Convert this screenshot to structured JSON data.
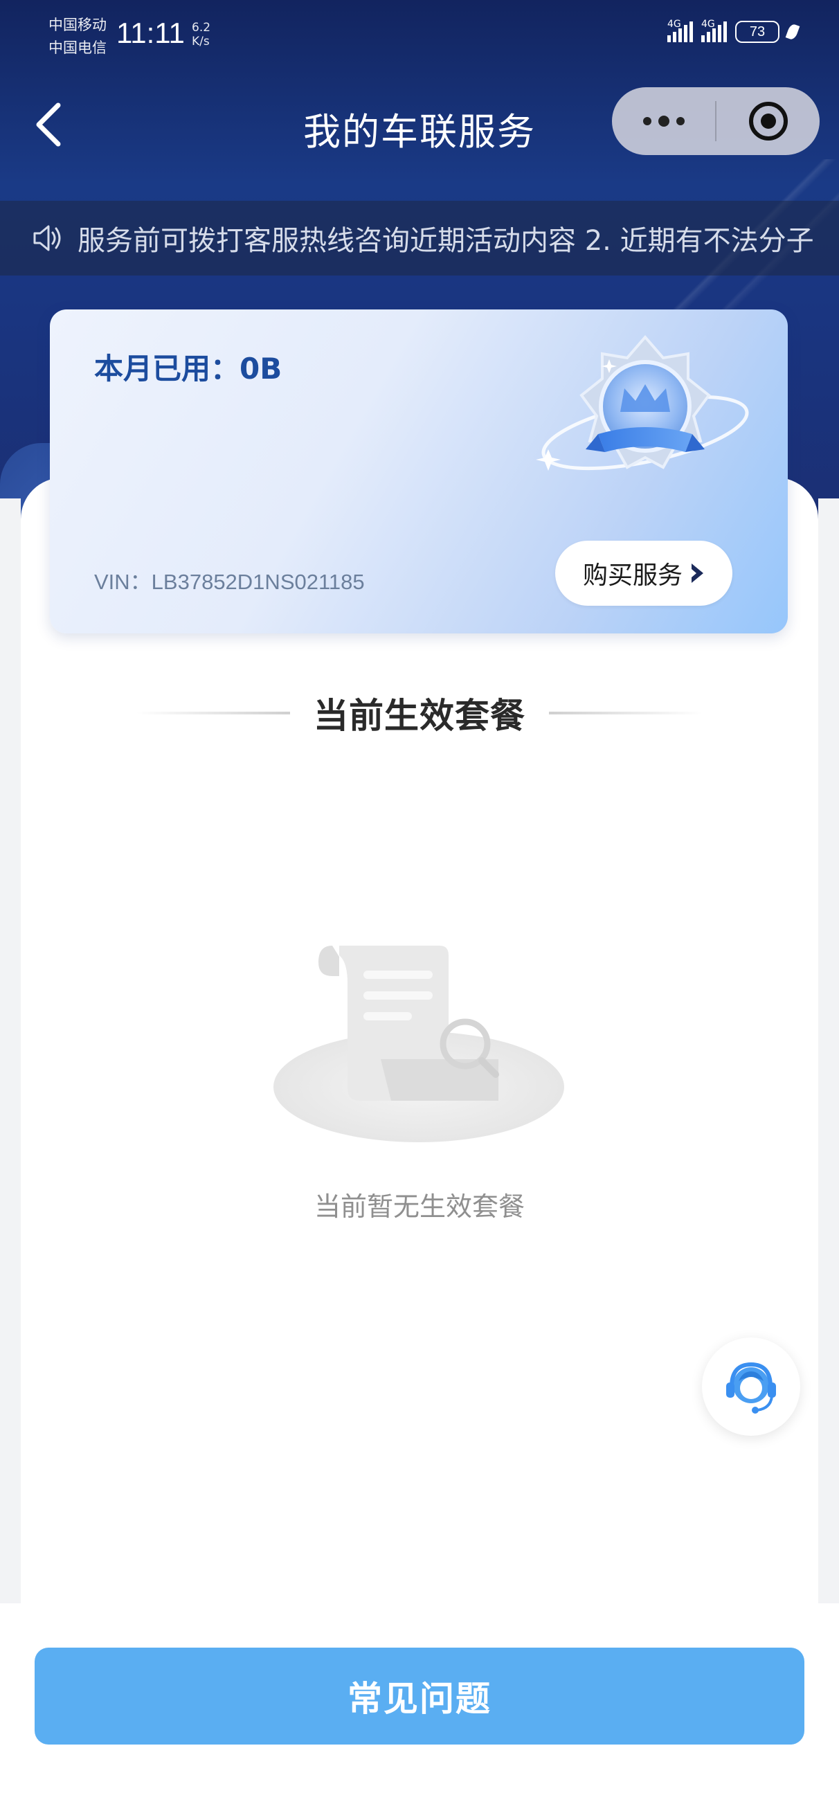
{
  "status_bar": {
    "carrier_1": "中国移动",
    "carrier_2": "中国电信",
    "time": "11:11",
    "net_speed_value": "6.2",
    "net_speed_unit": "K/s",
    "signal_1_tag": "4G",
    "signal_2_tag": "4G",
    "battery": "73"
  },
  "nav": {
    "title": "我的车联服务"
  },
  "notice": {
    "text": "服务前可拨打客服热线咨询近期活动内容 2. 近期有不法分子"
  },
  "usage_card": {
    "usage_label": "本月已用：0B",
    "vin": "VIN：LB37852D1NS021185",
    "buy_button_label": "购买服务"
  },
  "section": {
    "title": "当前生效套餐"
  },
  "empty_state": {
    "text": "当前暂无生效套餐"
  },
  "bottom": {
    "faq_button_label": "常见问题"
  },
  "colors": {
    "header_bg": "#1a3a86",
    "accent_blue": "#5aaef2",
    "usage_text": "#1c4c9e"
  }
}
